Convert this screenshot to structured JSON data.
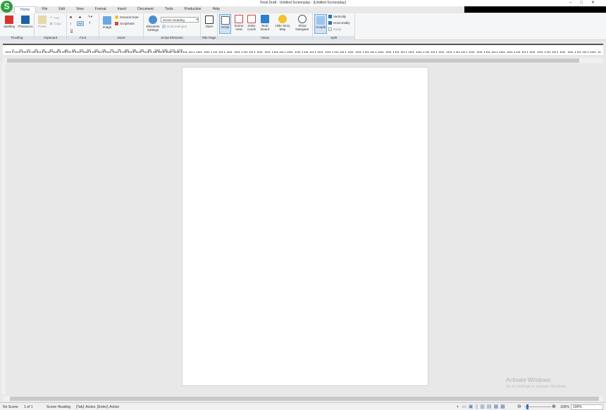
{
  "window": {
    "title": "Final Draft - Untitled Screenplay - [Untitled Screenplay]",
    "logo": "Final Draft logo"
  },
  "tabs": [
    "Home",
    "File",
    "Edit",
    "View",
    "Format",
    "Insert",
    "Document",
    "Tools",
    "Production",
    "Help"
  ],
  "ribbon": {
    "proofing": {
      "label": "Proofing",
      "spelling": "Spelling",
      "thesaurus": "Thesaurus"
    },
    "clipboard": {
      "label": "Clipboard",
      "paste": "Paste",
      "cut": "Cut",
      "copy": "Copy"
    },
    "font": {
      "label": "Font",
      "bold": "B",
      "italic": "I",
      "underline": "U",
      "strike": "S",
      "aa": "AA",
      "t": "T"
    },
    "insert": {
      "label": "Insert",
      "image": "Image",
      "general_note": "General Note",
      "scriptnote": "ScriptNote"
    },
    "script_elements": {
      "label": "Script Elements",
      "settings": "Elements Settings",
      "element_select": "Scene Heading",
      "dual_dialogue": "Dual Dialogue"
    },
    "title_page": {
      "label": "Title Page",
      "open": "Open"
    },
    "views": {
      "label": "Views",
      "script": "Script",
      "scene_view": "Scene View",
      "index_cards": "Index Cards",
      "beat_board": "Beat Board",
      "hide_story_map": "Hide Story Map",
      "show_navigator": "Show Navigator"
    },
    "split": {
      "label": "Split",
      "unsplit": "Unsplit",
      "vertically": "Vertically",
      "horizontally": "Horizontally",
      "swap": "Swap"
    }
  },
  "ruler": {
    "labels": [
      "5",
      "10",
      "15",
      "20",
      "25",
      "30",
      "35",
      "40",
      "45",
      "50",
      "55",
      "60",
      "65",
      "70",
      "75",
      "80",
      "85",
      "90",
      "95",
      "100",
      "105",
      "110",
      "115"
    ]
  },
  "status": {
    "scene": "No Scene",
    "page": "1 of 1",
    "element": "Scene Heading",
    "hint": "[Tab]: Action, [Enter]: Action",
    "zoom": "100%",
    "zoom_select": "100%"
  },
  "watermark": {
    "line1": "Activate Windows",
    "line2": "Go to Settings to activate Windows."
  },
  "colors": {
    "accent": "#1f5fa8",
    "logo": "#2e9e3e"
  }
}
